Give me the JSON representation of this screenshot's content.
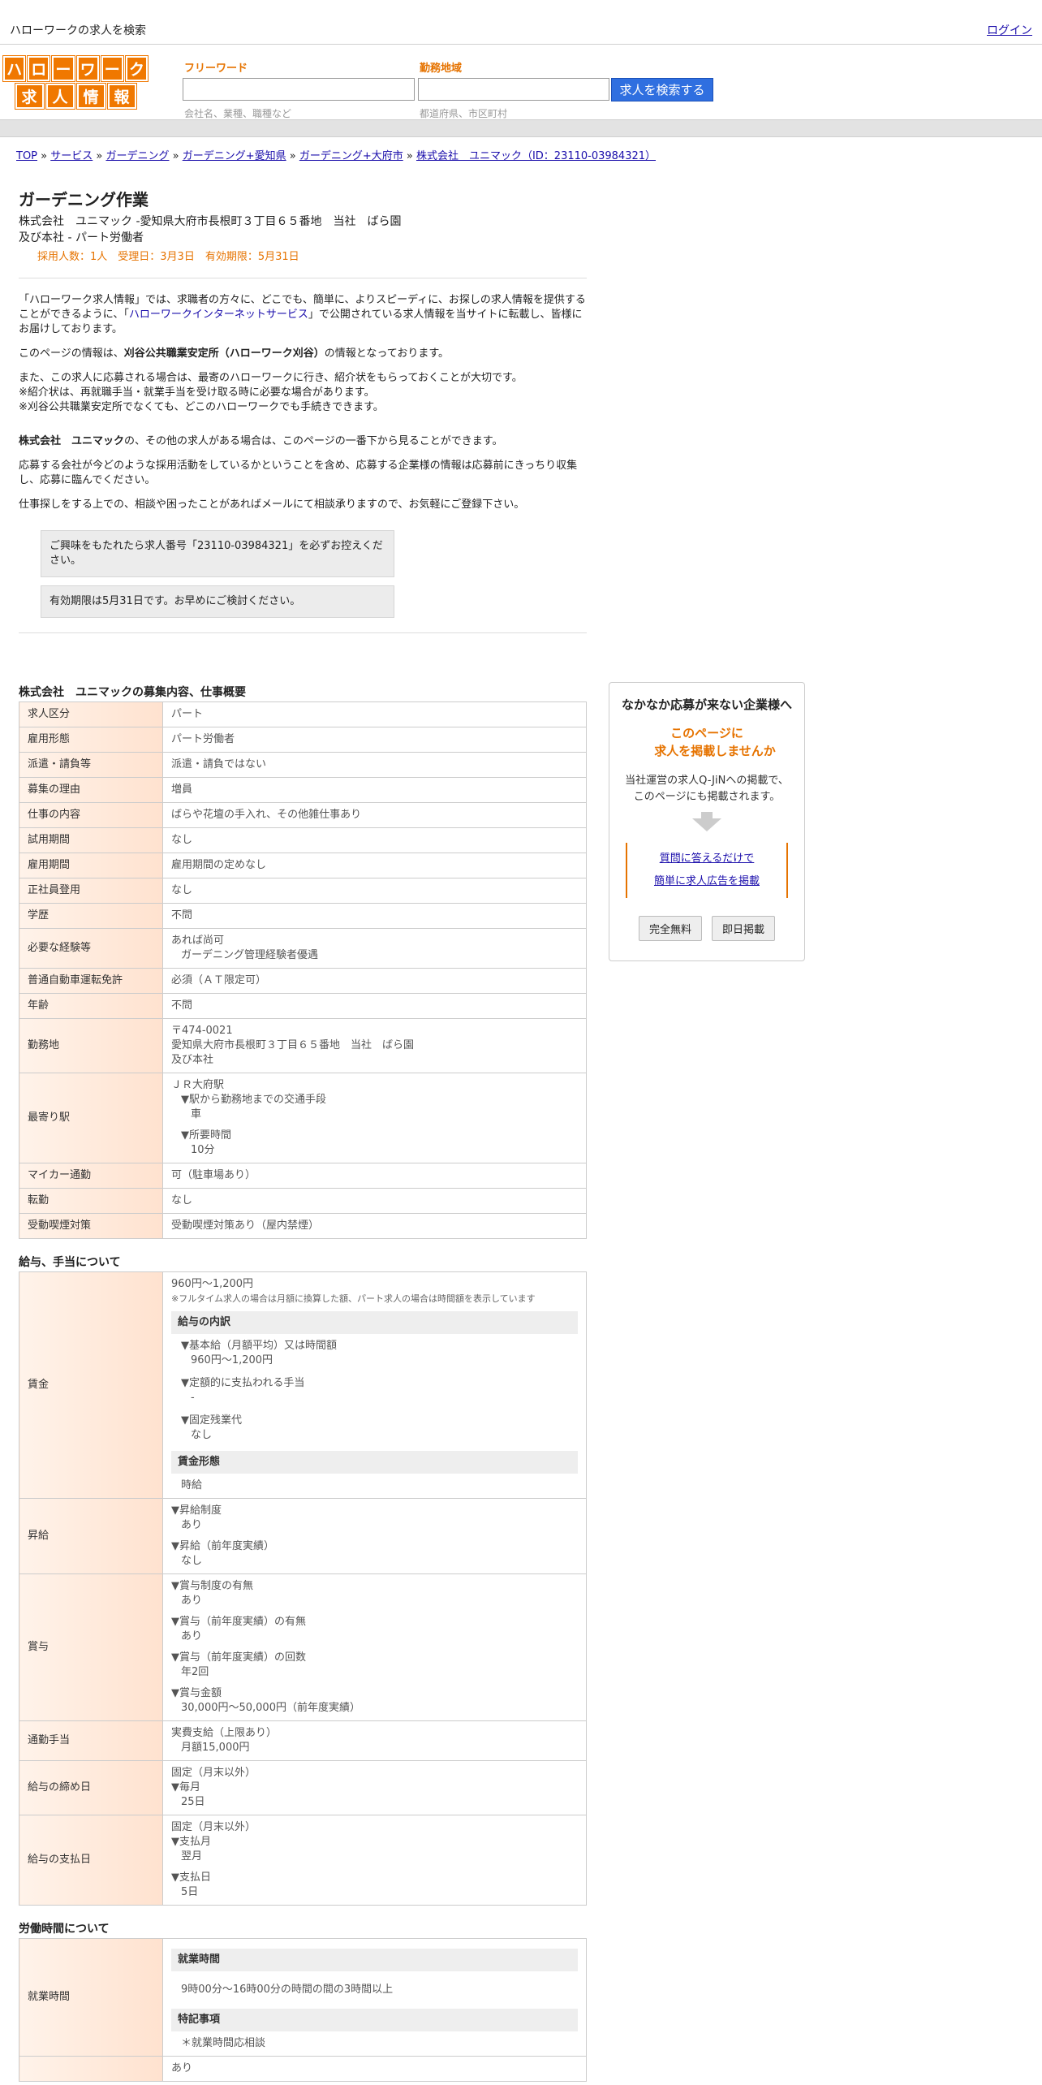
{
  "topbar": {
    "site_title": "ハローワークの求人を検索",
    "login": "ログイン"
  },
  "logo": {
    "row1": [
      "ハ",
      "ロ",
      "ー",
      "ワ",
      "ー",
      "ク"
    ],
    "row2": [
      "求",
      "人",
      "情",
      "報"
    ]
  },
  "search": {
    "keyword_label": "フリーワード",
    "keyword_hint": "会社名、業種、職種など",
    "area_label": "勤務地域",
    "area_hint": "都道府県、市区町村",
    "button": "求人を検索する"
  },
  "breadcrumb": [
    "TOP",
    "サービス",
    "ガーデニング",
    "ガーデニング+愛知県",
    "ガーデニング+大府市",
    "株式会社　ユニマック（ID：23110-03984321）"
  ],
  "job": {
    "title": "ガーデニング作業",
    "company_line1": "株式会社　ユニマック -愛知県大府市長根町３丁目６５番地　当社　ばら園",
    "company_line2": "及び本社 - パート労働者",
    "meta": "採用人数：1人　受理日：3月3日　有効期限：5月31日"
  },
  "intro": {
    "p1a": "「ハローワーク求人情報」では、求職者の方々に、どこでも、簡単に、よりスピーディに、お探しの求人情報を提供することができるように、「",
    "p1_link": "ハローワークインターネットサービス",
    "p1b": "」で公開されている求人情報を当サイトに転載し、皆様にお届けしております。",
    "p2a": "このページの情報は、",
    "p2_bold": "刈谷公共職業安定所（ハローワーク刈谷）",
    "p2b": "の情報となっております。",
    "p3_l1": "また、この求人に応募される場合は、最寄のハローワークに行き、紹介状をもらっておくことが大切です。",
    "p3_l2": "※紹介状は、再就職手当・就業手当を受け取る時に必要な場合があります。",
    "p3_l3": "※刈谷公共職業安定所でなくても、どこのハローワークでも手続きできます。",
    "p4_bold": "株式会社　ユニマック",
    "p4": "の、その他の求人がある場合は、このページの一番下から見ることができます。",
    "p5": "応募する会社が今どのような採用活動をしているかということを含め、応募する企業様の情報は応募前にきっちり収集し、応募に臨んでください。",
    "p6": "仕事探しをする上での、相談や困ったことがあればメールにて相談承りますので、お気軽にご登録下さい。",
    "notice1": "ご興味をもたれたら求人番号「23110-03984321」を必ずお控えください。",
    "notice2": "有効期限は5月31日です。お早めにご検討ください。"
  },
  "overview": {
    "title": "株式会社　ユニマックの募集内容、仕事概要",
    "rows": [
      {
        "k": "求人区分",
        "v": "パート"
      },
      {
        "k": "雇用形態",
        "v": "パート労働者"
      },
      {
        "k": "派遣・請負等",
        "v": "派遣・請負ではない"
      },
      {
        "k": "募集の理由",
        "v": "増員"
      },
      {
        "k": "仕事の内容",
        "v": "ばらや花壇の手入れ、その他雑仕事あり"
      },
      {
        "k": "試用期間",
        "v": "なし"
      },
      {
        "k": "雇用期間",
        "v": "雇用期間の定めなし"
      },
      {
        "k": "正社員登用",
        "v": "なし"
      },
      {
        "k": "学歴",
        "v": "不問"
      }
    ],
    "experience_k": "必要な経験等",
    "experience_v1": "あれば尚可",
    "experience_v2": "ガーデニング管理経験者優遇",
    "license_k": "普通自動車運転免許",
    "license_v": "必須（ＡＴ限定可）",
    "age_k": "年齢",
    "age_v": "不問",
    "location_k": "勤務地",
    "location_v1": "〒474-0021",
    "location_v2": "愛知県大府市長根町３丁目６５番地　当社　ばら園",
    "location_v3": "及び本社",
    "station_k": "最寄り駅",
    "station_v1": "ＪＲ大府駅",
    "station_v2": "▼駅から勤務地までの交通手段",
    "station_v3": "車",
    "station_v4": "▼所要時間",
    "station_v5": "10分",
    "car_k": "マイカー通勤",
    "car_v": "可（駐車場あり）",
    "transfer_k": "転勤",
    "transfer_v": "なし",
    "smoke_k": "受動喫煙対策",
    "smoke_v": "受動喫煙対策あり（屋内禁煙）"
  },
  "salary": {
    "title": "給与、手当について",
    "wage_k": "賃金",
    "wage_v": "960円〜1,200円",
    "wage_note": "※フルタイム求人の場合は月額に換算した額、パート求人の場合は時間額を表示しています",
    "breakdown_head": "給与の内訳",
    "b1": "▼基本給（月額平均）又は時間額",
    "b1v": "960円〜1,200円",
    "b2": "▼定額的に支払われる手当",
    "b2v": "-",
    "b3": "▼固定残業代",
    "b3v": "なし",
    "form_head": "賃金形態",
    "form_v": "時給",
    "raise_k": "昇給",
    "r1": "▼昇給制度",
    "r1v": "あり",
    "r2": "▼昇給（前年度実績）",
    "r2v": "なし",
    "bonus_k": "賞与",
    "bo1": "▼賞与制度の有無",
    "bo1v": "あり",
    "bo2": "▼賞与（前年度実績）の有無",
    "bo2v": "あり",
    "bo3": "▼賞与（前年度実績）の回数",
    "bo3v": "年2回",
    "bo4": "▼賞与金額",
    "bo4v": "30,000円〜50,000円（前年度実績）",
    "commute_k": "通勤手当",
    "commute_v1": "実費支給（上限あり）",
    "commute_v2": "月額15,000円",
    "close_k": "給与の締め日",
    "close_v1": "固定（月末以外）",
    "close_v2": "▼毎月",
    "close_v3": "25日",
    "pay_k": "給与の支払日",
    "pay_v1": "固定（月末以外）",
    "pay_v2": "▼支払月",
    "pay_v3": "翌月",
    "pay_v4": "▼支払日",
    "pay_v5": "5日"
  },
  "hours": {
    "title": "労働時間について",
    "work_k": "就業時間",
    "work_head": "就業時間",
    "work_v": "9時00分〜16時00分の時間の間の3時間以上",
    "note_head": "特記事項",
    "note_v": "＊就業時間応相談",
    "next_v": "あり"
  },
  "side": {
    "title": "なかなか応募が来ない企業様へ",
    "orange1": "このページに",
    "orange2": "求人を掲載しませんか",
    "text1": "当社運営の求人Q-JiNへの掲載で、",
    "text2": "このページにも掲載されます。",
    "link1": "質問に答えるだけで",
    "link2": "簡単に求人広告を掲載",
    "btn1": "完全無料",
    "btn2": "即日掲載"
  }
}
